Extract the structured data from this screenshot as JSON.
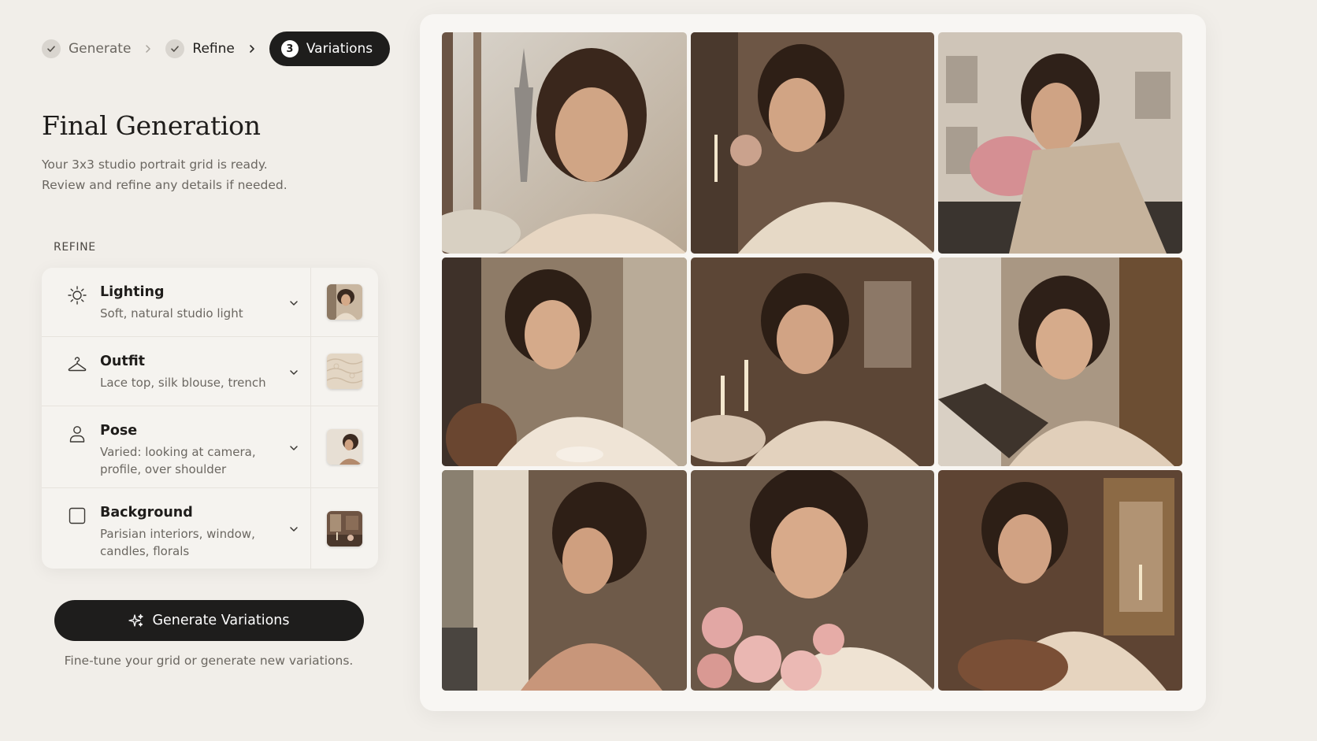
{
  "stepper": {
    "steps": [
      {
        "label": "Generate",
        "state": "done"
      },
      {
        "label": "Refine",
        "state": "done"
      },
      {
        "label": "Variations",
        "state": "active",
        "number": "3"
      }
    ]
  },
  "header": {
    "title": "Final Generation",
    "subtitle_line1": "Your 3x3 studio portrait grid is ready.",
    "subtitle_line2": "Review and refine any details if needed."
  },
  "refine": {
    "section_label": "REFINE",
    "items": [
      {
        "title": "Lighting",
        "desc_line1": "Soft, natural studio light",
        "desc_line2": "",
        "icon": "sun-icon"
      },
      {
        "title": "Outfit",
        "desc_line1": "Lace top, silk blouse, trench",
        "desc_line2": "",
        "icon": "hanger-icon"
      },
      {
        "title": "Pose",
        "desc_line1": "Varied: looking at camera,",
        "desc_line2": "profile, over shoulder",
        "icon": "person-icon"
      },
      {
        "title": "Background",
        "desc_line1": "Parisian interiors, window,",
        "desc_line2": "candles, florals",
        "icon": "frame-icon"
      }
    ]
  },
  "actions": {
    "generate_label": "Generate Variations",
    "hint": "Fine-tune your grid or generate new variations."
  },
  "colors": {
    "background": "#f1eee9",
    "primary_dark": "#1e1d1c",
    "muted_text": "#6b6761",
    "panel": "#f8f6f3"
  }
}
